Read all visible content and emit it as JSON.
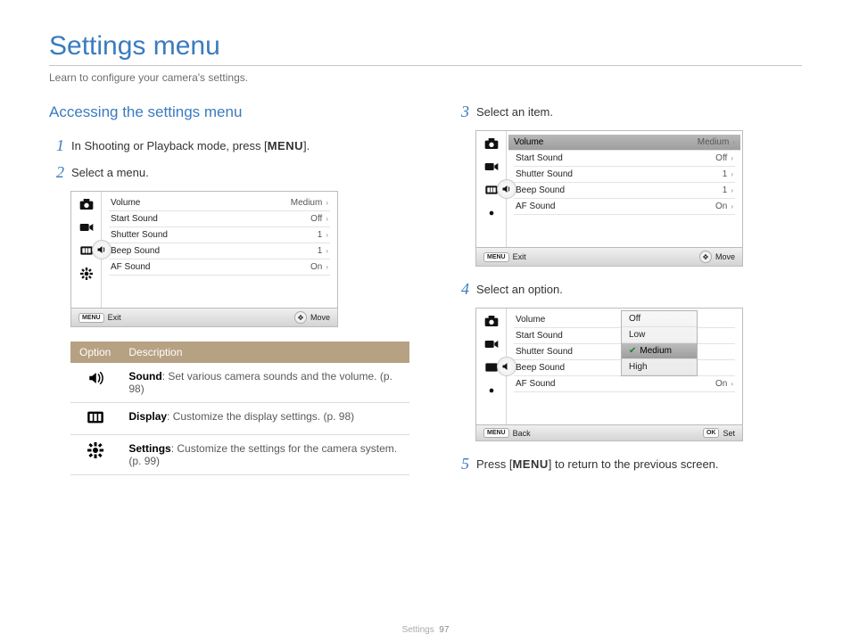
{
  "page": {
    "title": "Settings menu",
    "intro": "Learn to configure your camera's settings.",
    "section_heading": "Accessing the settings menu"
  },
  "steps": {
    "s1": {
      "num": "1",
      "text_a": "In Shooting or Playback mode, press [",
      "text_b": "]."
    },
    "s2": {
      "num": "2",
      "text": "Select a menu."
    },
    "s3": {
      "num": "3",
      "text": "Select an item."
    },
    "s4": {
      "num": "4",
      "text": "Select an option."
    },
    "s5": {
      "num": "5",
      "text_a": "Press [",
      "text_b": "] to return to the previous screen."
    }
  },
  "menu_word": "MENU",
  "camera_menu": {
    "rows": [
      {
        "label": "Volume",
        "value": "Medium"
      },
      {
        "label": "Start Sound",
        "value": "Off"
      },
      {
        "label": "Shutter Sound",
        "value": "1"
      },
      {
        "label": "Beep Sound",
        "value": "1"
      },
      {
        "label": "AF Sound",
        "value": "On"
      }
    ],
    "foot_menu": "MENU",
    "foot_exit": "Exit",
    "foot_move": "Move",
    "foot_back": "Back",
    "foot_ok": "OK",
    "foot_set": "Set"
  },
  "dropdown": {
    "items": [
      "Off",
      "Low",
      "Medium",
      "High"
    ]
  },
  "option_table": {
    "h1": "Option",
    "h2": "Description",
    "rows": [
      {
        "title": "Sound",
        "desc": ": Set various camera sounds and the volume. (p. 98)"
      },
      {
        "title": "Display",
        "desc": ": Customize the display settings. (p. 98)"
      },
      {
        "title": "Settings",
        "desc": ": Customize the settings for the camera system. (p. 99)"
      }
    ]
  },
  "footer": {
    "section": "Settings",
    "page": "97"
  }
}
